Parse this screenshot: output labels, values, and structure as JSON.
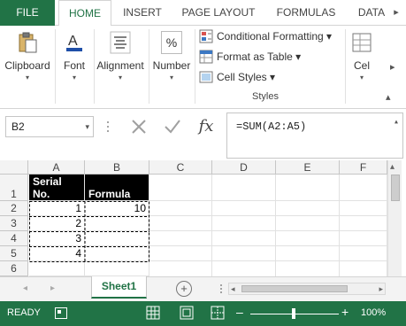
{
  "ribbon_tabs": {
    "file": "FILE",
    "items": [
      "HOME",
      "INSERT",
      "PAGE LAYOUT",
      "FORMULAS",
      "DATA"
    ],
    "active": "HOME",
    "scroll_glyph": "▸"
  },
  "ribbon": {
    "clipboard": {
      "label": "Clipboard",
      "caret": "▾"
    },
    "font": {
      "label": "Font",
      "caret": "▾"
    },
    "alignment": {
      "label": "Alignment",
      "caret": "▾"
    },
    "number": {
      "label": "Number",
      "caret": "▾",
      "icon_text": "%"
    },
    "conditional_formatting": "Conditional Formatting ▾",
    "format_as_table": "Format as Table ▾",
    "cell_styles": "Cell Styles ▾",
    "styles_group_label": "Styles",
    "cells": {
      "label": "Cel",
      "caret": "▾"
    },
    "collapse_glyph": "▴",
    "more_glyph": "▸"
  },
  "formula_bar": {
    "name_box": "B2",
    "name_box_caret": "▾",
    "formula": "=SUM(A2:A5)",
    "fx_label": "fx",
    "expand_glyph": "▴"
  },
  "sheet": {
    "columns": [
      "A",
      "B",
      "C",
      "D",
      "E",
      "F"
    ],
    "rows": [
      "1",
      "2",
      "3",
      "4",
      "5",
      "6"
    ],
    "header_cells": {
      "a1_line1": "Serial",
      "a1_line2": "No.",
      "b1": "Formula"
    },
    "data": {
      "a2": "1",
      "a3": "2",
      "a4": "3",
      "a5": "4",
      "b2": "10"
    },
    "scroll_up_glyph": "▴"
  },
  "sheet_tabs": {
    "nav_left": "◂",
    "nav_right": "▸",
    "tabs": [
      "Sheet1"
    ],
    "add_glyph": "+",
    "hscroll_left": "◂",
    "hscroll_right": "▸"
  },
  "status_bar": {
    "ready": "READY",
    "zoom_minus": "–",
    "zoom_plus": "+",
    "zoom": "100%"
  },
  "colors": {
    "accent": "#217346",
    "header_fill": "#000000",
    "header_text": "#ffffff"
  }
}
